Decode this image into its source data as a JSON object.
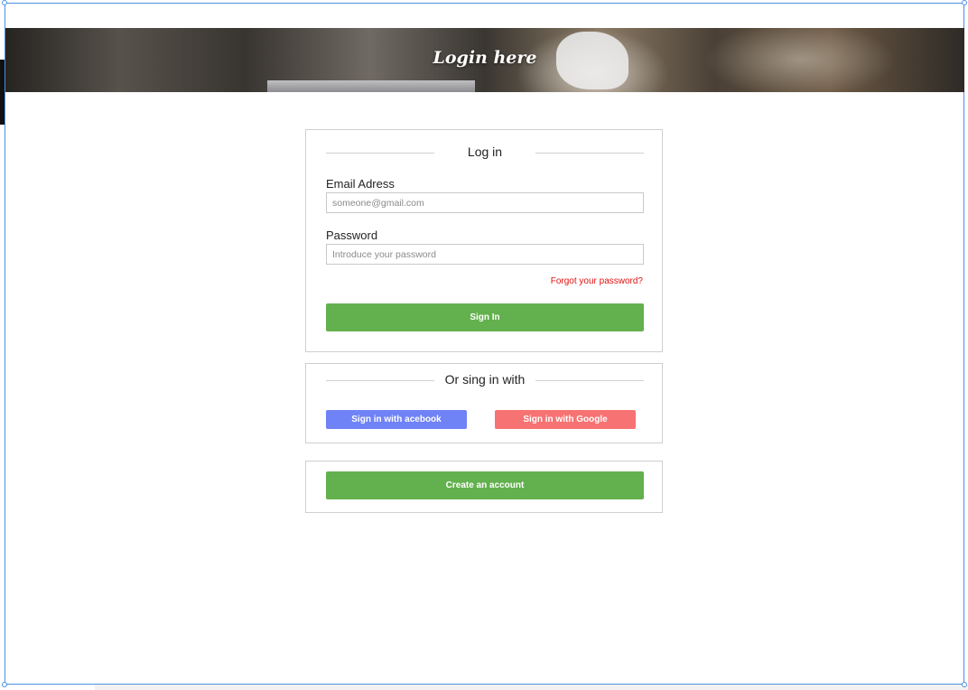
{
  "banner": {
    "title": "Login here"
  },
  "login": {
    "heading": "Log in",
    "email_label": "Email Adress",
    "email_placeholder": "someone@gmail.com",
    "password_label": "Password",
    "password_placeholder": "Introduce your password",
    "forgot_label": "Forgot your password?",
    "signin_label": "Sign In"
  },
  "social": {
    "heading": "Or sing in with",
    "facebook_label": "Sign in with acebook",
    "google_label": "Sign in with Google"
  },
  "create": {
    "label": "Create an account"
  },
  "colors": {
    "primary_green": "#63b04e",
    "facebook_blue": "#6f82f6",
    "google_red": "#f77272",
    "link_red": "#e11010",
    "selection_blue": "#4a90e2"
  }
}
